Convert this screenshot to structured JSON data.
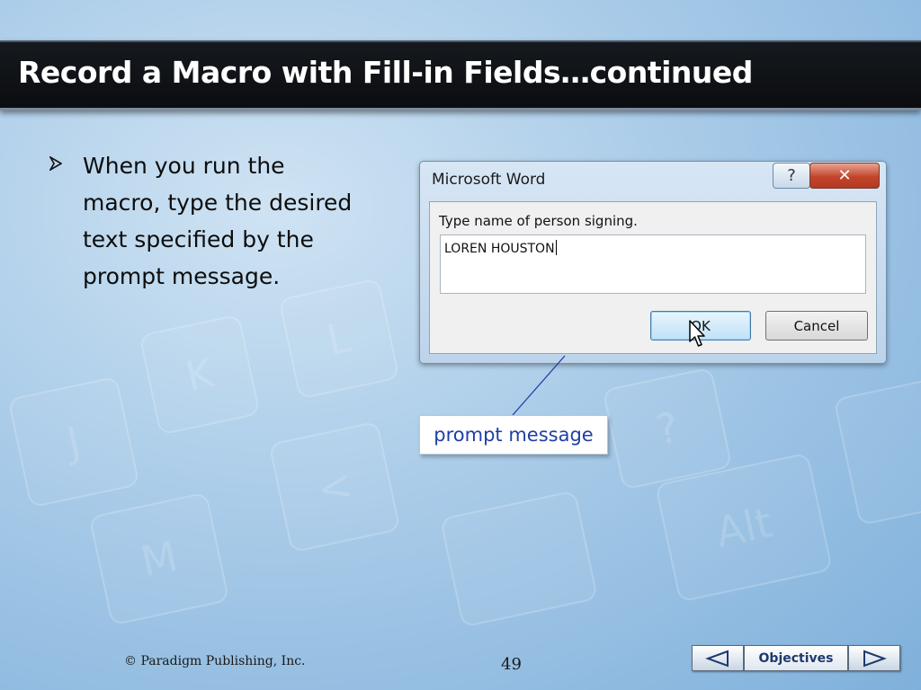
{
  "slide": {
    "title": "Record a Macro with Fill-in Fields…continued",
    "bullet_text": "When you run the macro, type the desired text specified by the prompt message."
  },
  "background": {
    "key_labels": [
      "J",
      "K",
      "L",
      "M",
      "<",
      "?",
      "Alt"
    ]
  },
  "dialog": {
    "title": "Microsoft Word",
    "help_label": "?",
    "close_label": "✕",
    "prompt_label": "Type name of person signing.",
    "input_value": "LOREN HOUSTON",
    "ok_label": "OK",
    "cancel_label": "Cancel"
  },
  "callout": {
    "label": "prompt message"
  },
  "footer": {
    "copyright": "© Paradigm Publishing, Inc.",
    "page_number": "49",
    "nav_label": "Objectives"
  },
  "colors": {
    "title_bar": "#111418",
    "callout_text": "#1f3fa3",
    "close_button": "#c2452b"
  }
}
